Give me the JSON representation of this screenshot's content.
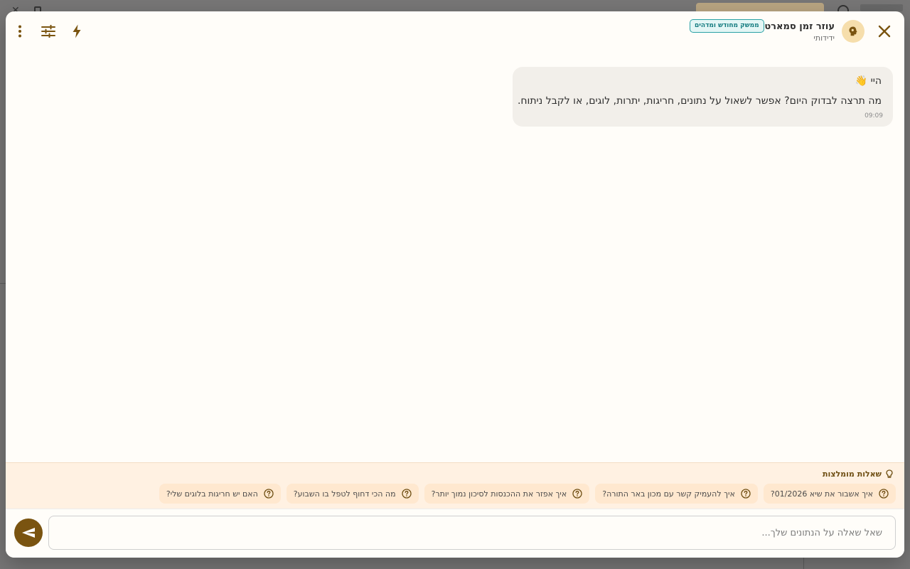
{
  "assistant": {
    "name": "עוזר זמן סמארט",
    "tone": "ידידותי",
    "badge": "ממשק מחודש ומדהים"
  },
  "messages": [
    {
      "greeting": "היי 👋",
      "text": "מה תרצה לבדוק היום? אפשר לשאול על נתונים, חריגות, יתרות, לוגים, או לקבל ניתוח.",
      "time": "09:09"
    }
  ],
  "suggestions": {
    "title": "שאלות מומלצות",
    "items": [
      {
        "label": "איך אשבור את שיא 01/2026?"
      },
      {
        "label": "איך להעמיק קשר עם מכון באר התורה?"
      },
      {
        "label": "איך אפזר את ההכנסות לסיכון נמוך יותר?"
      },
      {
        "label": "מה הכי דחוף לטפל בו השבוע?"
      },
      {
        "label": "האם יש חריגות בלוגים שלי?"
      }
    ]
  },
  "composer": {
    "placeholder": "שאל שאלה על הנתונים שלך...",
    "value": ""
  },
  "icons": {
    "close": "close-icon",
    "more": "more-vertical-icon",
    "tune": "tune-icon",
    "bolt": "bolt-icon",
    "avatar": "brain-icon",
    "lightbulb": "lightbulb-icon",
    "send": "send-icon"
  },
  "colors": {
    "accent": "#7a5410",
    "badge_border": "#2aa1a5",
    "suggest_bg": "#fff1e2",
    "chip_bg": "#ffe8cf"
  }
}
